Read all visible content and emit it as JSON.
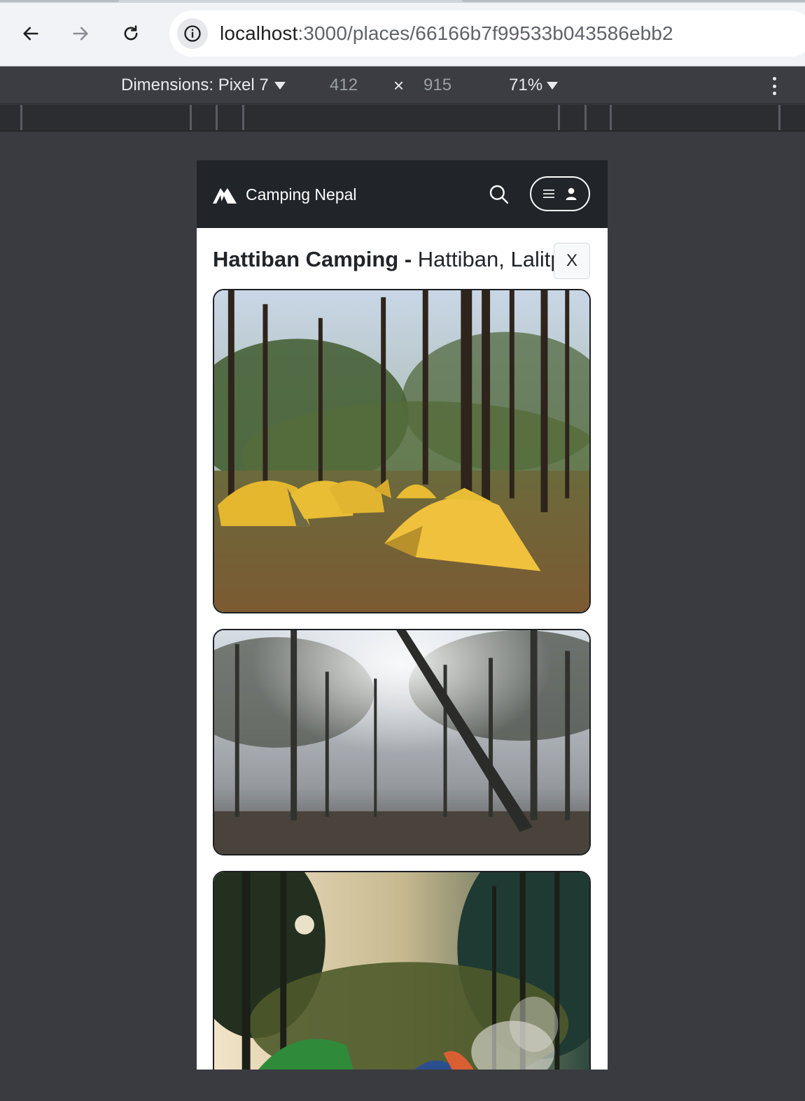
{
  "browser": {
    "url_host": "localhost",
    "url_path": ":3000/places/66166b7f99533b043586ebb2"
  },
  "devtools": {
    "dimensions_label": "Dimensions: Pixel 7",
    "width": "412",
    "times": "×",
    "height": "915",
    "zoom": "71%"
  },
  "app": {
    "brand_name": "Camping Nepal",
    "navbar_color": "#212529"
  },
  "place": {
    "name": "Hattiban Camping",
    "separator": " - ",
    "location": "Hattiban, Lalitpur",
    "close_label": "X"
  },
  "photos": [
    {
      "subject": "yellow tents under pine forest"
    },
    {
      "subject": "misty pine forest with leaning tree"
    },
    {
      "subject": "camping tents with campfire smoke in forest"
    }
  ]
}
